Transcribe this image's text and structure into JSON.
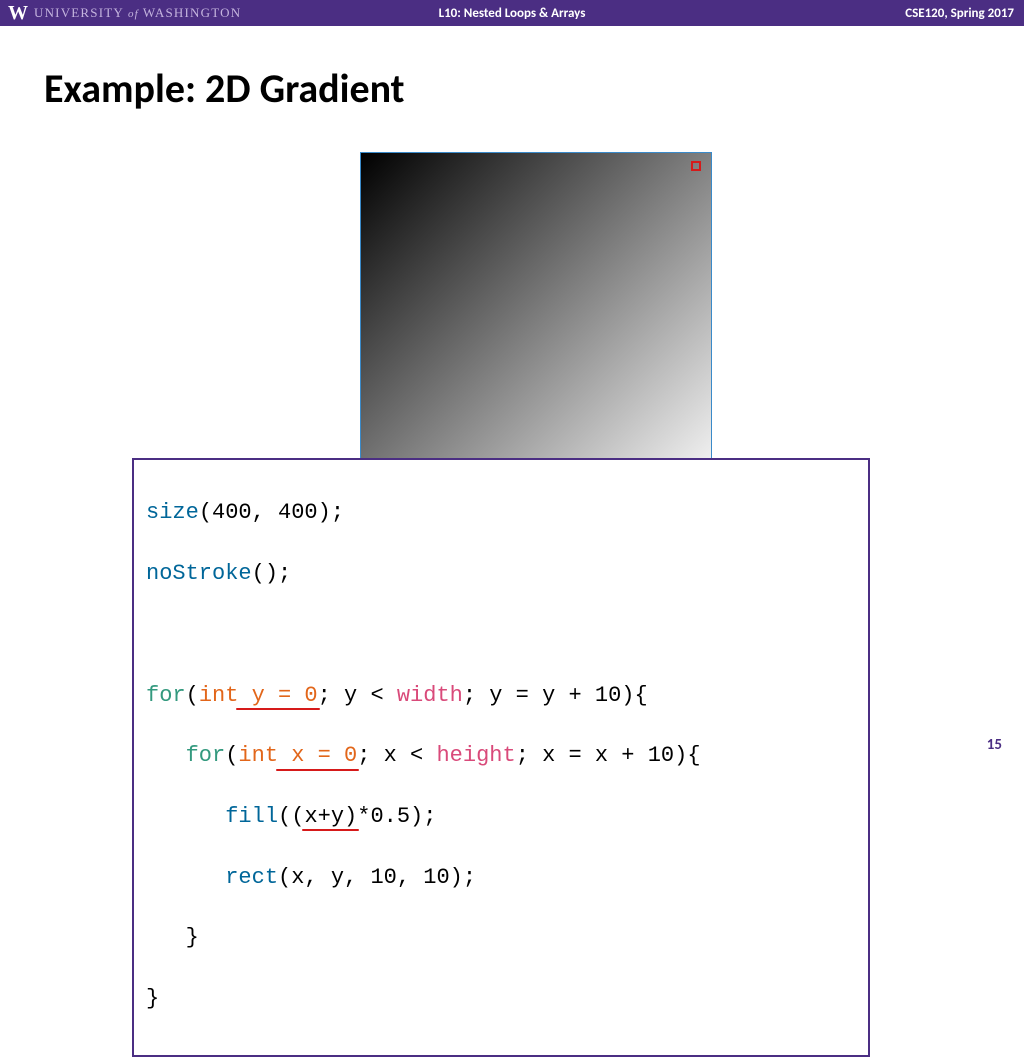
{
  "header": {
    "logo_text_1": "UNIVERSITY",
    "logo_text_of": " of ",
    "logo_text_2": "WASHINGTON",
    "center": "L10: Nested Loops & Arrays",
    "right": "CSE120, Spring 2017"
  },
  "title": "Example:  2D Gradient",
  "code": {
    "l1_fn": "size",
    "l1_rest": "(400, 400);",
    "l2_fn": "noStroke",
    "l2_rest": "();",
    "l4_for": "for",
    "l4_open": "(",
    "l4_int": "int",
    "l4_decl": " y = 0",
    "l4_mid": "; y < ",
    "l4_width": "width",
    "l4_end": "; y = y + 10){",
    "l5_indent": "   ",
    "l5_for": "for",
    "l5_open": "(",
    "l5_int": "int",
    "l5_decl": " x = 0",
    "l5_mid": "; x < ",
    "l5_height": "height",
    "l5_end": "; x = x + 10){",
    "l6_indent": "      ",
    "l6_fn": "fill",
    "l6_open": "((",
    "l6_expr": "x+y)",
    "l6_rest": "*0.5);",
    "l7_indent": "      ",
    "l7_fn": "rect",
    "l7_rest": "(x, y, 10, 10);",
    "l8": "   }",
    "l9": "}"
  },
  "page_number": "15"
}
